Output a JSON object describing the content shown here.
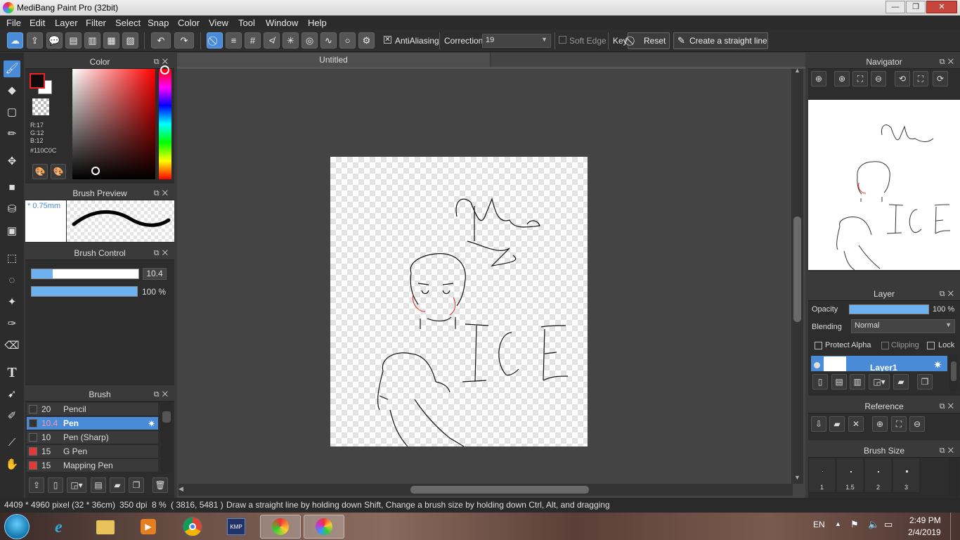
{
  "window": {
    "title": "MediBang Paint Pro (32bit)",
    "minimize": "—",
    "maximize": "❐",
    "close": "✕"
  },
  "menu": [
    "File",
    "Edit",
    "Layer",
    "Filter",
    "Select",
    "Snap",
    "Color",
    "View",
    "Tool",
    "Window",
    "Help"
  ],
  "toolbar": {
    "antialiasing_label": "AntiAliasing",
    "antialiasing_checked": "✕",
    "correction_label": "Correction",
    "correction_value": "19",
    "soft_edge_label": "Soft Edge",
    "key_label": "Key",
    "reset_label": "Reset",
    "straight_line_label": "Create a straight line"
  },
  "color_panel": {
    "title": "Color",
    "r": "R:17",
    "g": "G:12",
    "b": "B:12",
    "hex": "#110C0C",
    "fg_color": "#110c0c",
    "bg_color": "#ffffff"
  },
  "brush_preview": {
    "title": "Brush Preview",
    "size_label": "* 0.75mm"
  },
  "brush_control": {
    "title": "Brush Control",
    "size_value": "10.4",
    "opacity_value": "100 %",
    "size_fraction": 0.2,
    "opacity_fraction": 1.0
  },
  "brush_panel": {
    "title": "Brush",
    "items": [
      {
        "size": "20",
        "name": "Pencil",
        "color": "#333333"
      },
      {
        "size": "10.4",
        "name": "Pen",
        "color": "#333333"
      },
      {
        "size": "10",
        "name": "Pen (Sharp)",
        "color": "#333333"
      },
      {
        "size": "15",
        "name": "G Pen",
        "color": "#e53935"
      },
      {
        "size": "15",
        "name": "Mapping Pen",
        "color": "#e53935"
      }
    ]
  },
  "document": {
    "tab_title": "Untitled"
  },
  "navigator": {
    "title": "Navigator"
  },
  "layer_panel": {
    "title": "Layer",
    "opacity_label": "Opacity",
    "opacity_value": "100 %",
    "blending_label": "Blending",
    "blending_value": "Normal",
    "protect_alpha_label": "Protect Alpha",
    "clipping_label": "Clipping",
    "lock_label": "Lock",
    "layer_name": "Layer1"
  },
  "reference_panel": {
    "title": "Reference"
  },
  "brush_size_panel": {
    "title": "Brush Size",
    "sizes": [
      "1",
      "1.5",
      "2",
      "3"
    ]
  },
  "status": {
    "dimensions": "4409 * 4960 pixel",
    "physical": "(32 * 36cm)",
    "dpi": "350 dpi",
    "zoom": "8 %",
    "coords": "( 3816, 5481 )",
    "hint": "Draw a straight line by holding down Shift, Change a brush size by holding down Ctrl, Alt, and dragging"
  },
  "taskbar": {
    "language": "EN",
    "time": "2:49 PM",
    "date": "2/4/2019"
  },
  "colors": {
    "accent": "#4a8bd8",
    "panel_bg": "#2d2d2d",
    "header_bg": "#3a3a3a"
  }
}
